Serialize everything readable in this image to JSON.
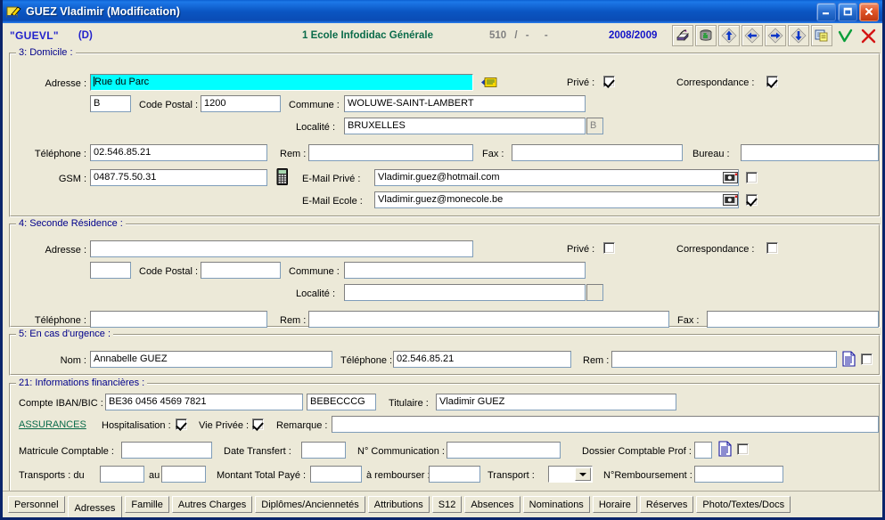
{
  "window": {
    "title": "GUEZ Vladimir (Modification)",
    "icon": "pencil-note-icon",
    "buttons": {
      "minimize": "minimize-button",
      "maximize": "maximize-button",
      "close": "close-button"
    }
  },
  "subheader": {
    "code": "\"GUEVL\"",
    "flag": "(D)",
    "school": "1 Ecole Infodidac Générale",
    "record_number": "510",
    "sep1": "/",
    "dash1": "-",
    "dash2": "-",
    "school_year": "2008/2009",
    "tools": [
      "print-icon",
      "archive-icon",
      "nav-first-icon",
      "nav-prev-icon",
      "nav-next-icon",
      "nav-last-icon",
      "notes-icon",
      "validate-icon",
      "cancel-icon"
    ]
  },
  "domicile": {
    "title": "3: Domicile :",
    "adresse_label": "Adresse :",
    "adresse_value": "Rue du Parc",
    "country_value": "B",
    "code_postal_label": "Code Postal :",
    "code_postal_value": "1200",
    "commune_label": "Commune :",
    "commune_value": "WOLUWE-SAINT-LAMBERT",
    "localite_label": "Localité :",
    "localite_value": "BRUXELLES",
    "localite_suffix": "B",
    "prive_label": "Privé :",
    "prive_checked": true,
    "correspondance_label": "Correspondance :",
    "correspondance_checked": true,
    "telephone_label": "Téléphone :",
    "telephone_value": "02.546.85.21",
    "rem_label": "Rem :",
    "rem_value": "",
    "fax_label": "Fax :",
    "fax_value": "",
    "bureau_label": "Bureau :",
    "bureau_value": "",
    "gsm_label": "GSM :",
    "gsm_value": "0487.75.50.31",
    "email_prive_label": "E-Mail Privé :",
    "email_prive_value": "Vladimir.guez@hotmail.com",
    "email_prive_checked": false,
    "email_ecole_label": "E-Mail Ecole :",
    "email_ecole_value": "Vladimir.guez@monecole.be",
    "email_ecole_checked": true
  },
  "seconde_residence": {
    "title": "4: Seconde Résidence :",
    "adresse_label": "Adresse :",
    "adresse_value": "",
    "country_value": "",
    "code_postal_label": "Code Postal :",
    "code_postal_value": "",
    "commune_label": "Commune :",
    "commune_value": "",
    "localite_label": "Localité :",
    "localite_value": "",
    "localite_suffix": "",
    "prive_label": "Privé :",
    "prive_checked": false,
    "correspondance_label": "Correspondance :",
    "correspondance_checked": false,
    "telephone_label": "Téléphone :",
    "telephone_value": "",
    "rem_label": "Rem :",
    "rem_value": "",
    "fax_label": "Fax :",
    "fax_value": ""
  },
  "urgence": {
    "title": "5: En cas d'urgence :",
    "nom_label": "Nom :",
    "nom_value": "Annabelle GUEZ",
    "telephone_label": "Téléphone :",
    "telephone_value": "02.546.85.21",
    "rem_label": "Rem :",
    "rem_value": "",
    "doc_icon": "document-icon",
    "doc_checked": false
  },
  "finances": {
    "title": "21: Informations financières :",
    "iban_label": "Compte IBAN/BIC :",
    "iban_value": "BE36 0456 4569 7821",
    "bic_value": "BEBECCCG",
    "titulaire_label": "Titulaire :",
    "titulaire_value": "Vladimir GUEZ",
    "assurances_link": "ASSURANCES",
    "hospitalisation_label": "Hospitalisation :",
    "hospitalisation_checked": true,
    "vie_privee_label": "Vie Privée :",
    "vie_privee_checked": true,
    "remarque_label": "Remarque :",
    "remarque_value": "",
    "matricule_label": "Matricule Comptable :",
    "matricule_value": "",
    "date_transfert_label": "Date Transfert :",
    "date_transfert_value": "",
    "num_communication_label": "N° Communication :",
    "num_communication_value": "",
    "dossier_label": "Dossier Comptable Prof :",
    "dossier_value": "",
    "dossier_icon": "document-icon",
    "dossier_checked": false,
    "transports_label": "Transports : du",
    "transports_du_value": "",
    "transports_au_label": "au",
    "transports_au_value": "",
    "montant_label": "Montant Total Payé :",
    "montant_value": "",
    "rembourser_label": "à rembourser :",
    "rembourser_value": "",
    "transport_label": "Transport :",
    "transport_value": "",
    "num_remboursement_label": "N°Remboursement :",
    "num_remboursement_value": ""
  },
  "tabs": [
    {
      "label": "Personnel",
      "active": false
    },
    {
      "label": "Adresses",
      "active": true
    },
    {
      "label": "Famille",
      "active": false
    },
    {
      "label": "Autres Charges",
      "active": false
    },
    {
      "label": "Diplômes/Anciennetés",
      "active": false
    },
    {
      "label": "Attributions",
      "active": false
    },
    {
      "label": "S12",
      "active": false
    },
    {
      "label": "Absences",
      "active": false
    },
    {
      "label": "Nominations",
      "active": false
    },
    {
      "label": "Horaire",
      "active": false
    },
    {
      "label": "Réserves",
      "active": false
    },
    {
      "label": "Photo/Textes/Docs",
      "active": false
    }
  ],
  "colors": {
    "title_blue": "#0a4cb5",
    "focus_cyan": "#00ffff",
    "group_title": "#00008b",
    "school_green": "#0a6b4a",
    "year_blue": "#1414c8",
    "link_green": "#0a6b4a",
    "face": "#ece9d8"
  }
}
